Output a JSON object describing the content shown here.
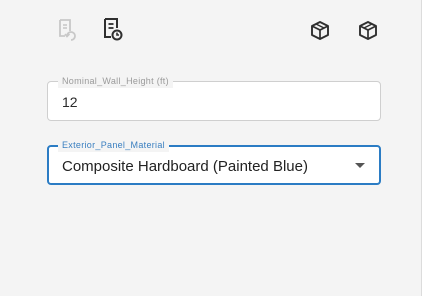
{
  "toolbar": {
    "icons": [
      "undo-document-icon",
      "document-history-icon",
      "package-icon",
      "package-add-icon"
    ]
  },
  "fields": {
    "wall_height": {
      "label": "Nominal_Wall_Height (ft)",
      "value": "12"
    },
    "panel_material": {
      "label": "Exterior_Panel_Material",
      "value": "Composite Hardboard (Painted Blue)"
    }
  },
  "colors": {
    "focus_accent": "#2b7cc4",
    "background": "#f4f4f4"
  }
}
